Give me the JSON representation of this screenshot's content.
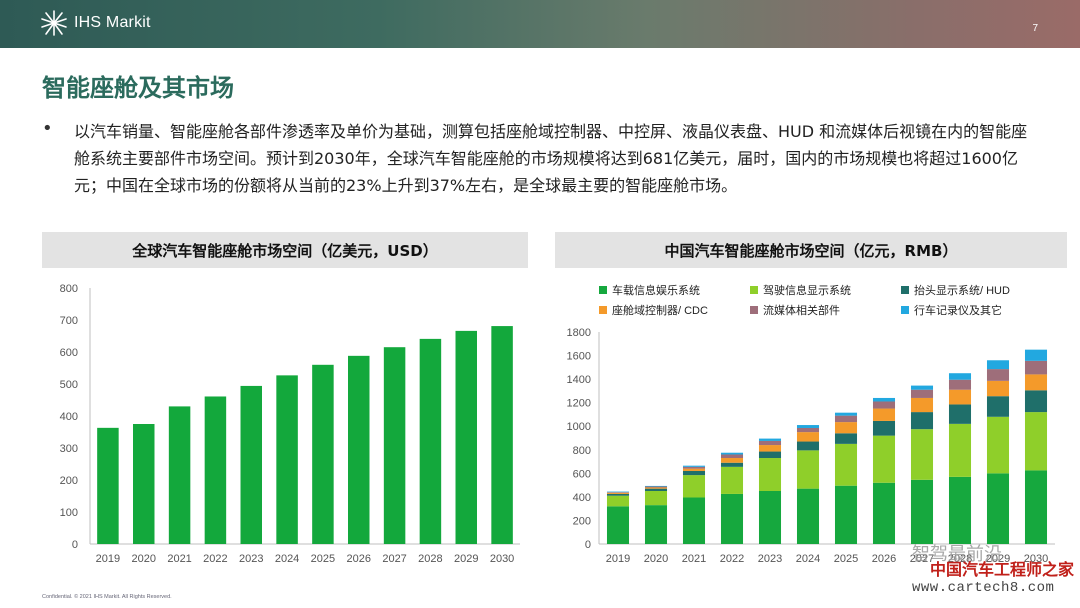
{
  "header": {
    "logo_text": "IHS Markit",
    "page_number": "7"
  },
  "slide": {
    "title": "智能座舱及其市场",
    "bullet_marker": "•",
    "bullet": "以汽车销量、智能座舱各部件渗透率及单价为基础，测算包括座舱域控制器、中控屏、液晶仪表盘、HUD 和流媒体后视镜在内的智能座舱系统主要部件市场空间。预计到2030年，全球汽车智能座舱的市场规模将达到681亿美元，届时，国内的市场规模也将超过1600亿元；中国在全球市场的份额将从当前的23%上升到37%左右，是全球最主要的智能座舱市场。"
  },
  "footer": {
    "text": "Confidential. © 2021 IHS Markit. All Rights Reserved."
  },
  "watermark": {
    "line1": "中国汽车工程师之家",
    "line2": "www.cartech8.com",
    "line3": "智驾最前沿"
  },
  "chart_data": [
    {
      "type": "bar",
      "title": "全球汽车智能座舱市场空间（亿美元，USD）",
      "categories": [
        "2019",
        "2020",
        "2021",
        "2022",
        "2023",
        "2024",
        "2025",
        "2026",
        "2027",
        "2028",
        "2029",
        "2030"
      ],
      "values": [
        363,
        375,
        430,
        461,
        494,
        527,
        560,
        588,
        615,
        641,
        666,
        681
      ],
      "ylim": [
        0,
        800
      ],
      "yticks": [
        0,
        100,
        200,
        300,
        400,
        500,
        600,
        700,
        800
      ],
      "color": "#13a83c",
      "grid": false
    },
    {
      "type": "stacked-bar",
      "title": "中国汽车智能座舱市场空间（亿元，RMB）",
      "categories": [
        "2019",
        "2020",
        "2021",
        "2022",
        "2023",
        "2024",
        "2025",
        "2026",
        "2027",
        "2028",
        "2029",
        "2030"
      ],
      "ylim": [
        0,
        1800
      ],
      "yticks": [
        0,
        200,
        400,
        600,
        800,
        1000,
        1200,
        1400,
        1600,
        1800
      ],
      "legend_position": "top",
      "series": [
        {
          "name": "车载信息娱乐系统",
          "color": "#16a83e",
          "values": [
            320,
            330,
            395,
            425,
            450,
            470,
            495,
            520,
            545,
            570,
            600,
            625
          ]
        },
        {
          "name": "驾驶信息显示系统",
          "color": "#8fcf2a",
          "values": [
            90,
            120,
            190,
            230,
            280,
            325,
            355,
            400,
            430,
            450,
            480,
            495
          ]
        },
        {
          "name": "抬头显示系统/ HUD",
          "color": "#1f6f6a",
          "values": [
            15,
            20,
            35,
            35,
            55,
            75,
            90,
            125,
            145,
            165,
            175,
            185
          ]
        },
        {
          "name": "座舱域控制器/ CDC",
          "color": "#f49a2a",
          "values": [
            10,
            10,
            20,
            40,
            55,
            80,
            95,
            105,
            120,
            125,
            130,
            135
          ]
        },
        {
          "name": "流媒体相关部件",
          "color": "#9e6e7a",
          "values": [
            5,
            8,
            15,
            30,
            35,
            35,
            55,
            60,
            70,
            85,
            100,
            115
          ]
        },
        {
          "name": "行车记录仪及其它",
          "color": "#22a8e0",
          "values": [
            5,
            5,
            10,
            15,
            20,
            25,
            25,
            30,
            35,
            55,
            75,
            95
          ]
        }
      ]
    }
  ]
}
